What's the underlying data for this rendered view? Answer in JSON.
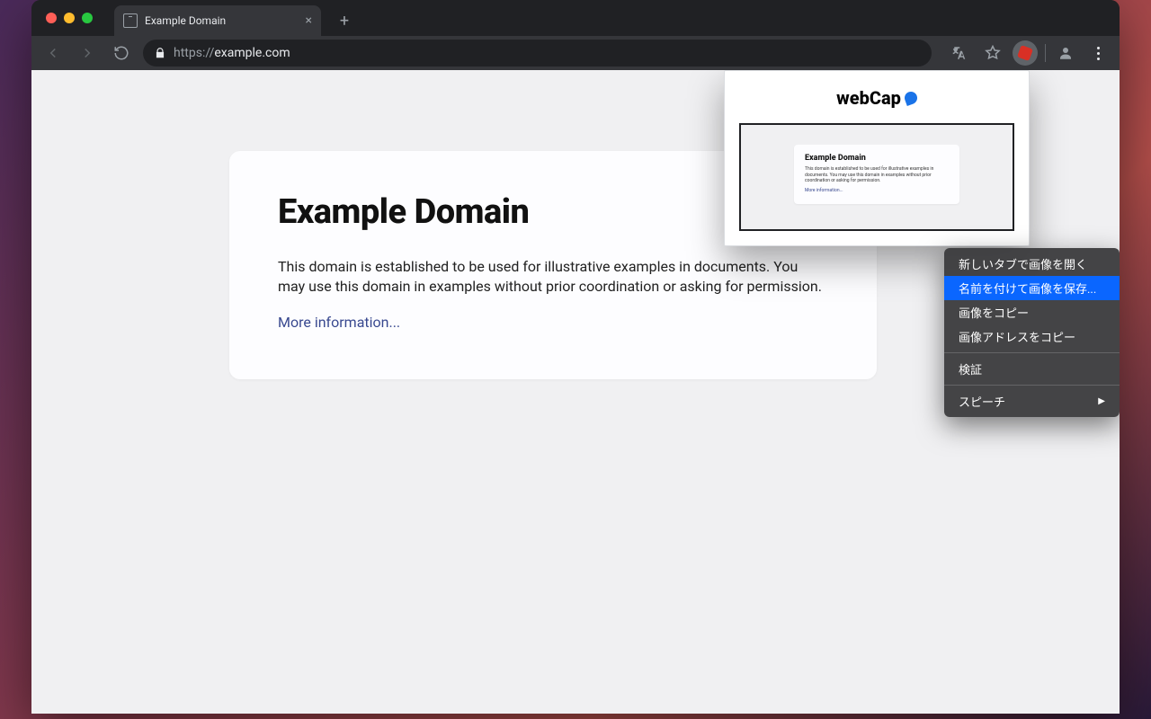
{
  "tab": {
    "title": "Example Domain"
  },
  "url": {
    "scheme": "https://",
    "host": "example.com"
  },
  "page": {
    "heading": "Example Domain",
    "body": "This domain is established to be used for illustrative examples in documents. You may use this domain in examples without prior coordination or asking for permission.",
    "link": "More information..."
  },
  "popup": {
    "title": "webCap",
    "mini_heading": "Example Domain",
    "mini_body": "This domain is established to be used for illustrative examples in documents. You may use this domain in examples without prior coordination or asking for permission.",
    "mini_link": "More information..."
  },
  "context_menu": {
    "items": [
      "新しいタブで画像を開く",
      "名前を付けて画像を保存...",
      "画像をコピー",
      "画像アドレスをコピー"
    ],
    "inspect": "検証",
    "speech": "スピーチ",
    "highlighted_index": 1
  }
}
